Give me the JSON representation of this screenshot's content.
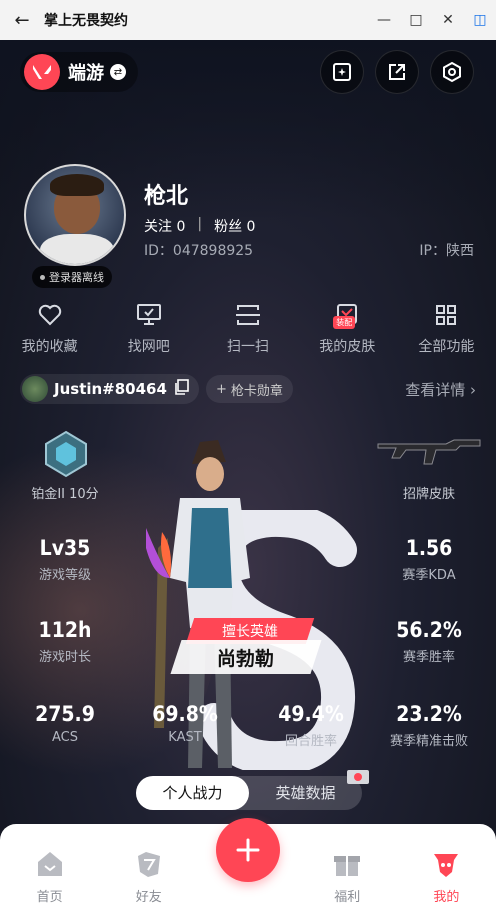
{
  "window": {
    "title": "掌上无畏契约"
  },
  "header": {
    "app_name": "端游"
  },
  "profile": {
    "username": "枪北",
    "follow_label": "关注",
    "follow_count": "0",
    "fans_label": "粉丝",
    "fans_count": "0",
    "id_text": "ID：047898925",
    "ip_text": "IP：陕西",
    "status": "登录器离线"
  },
  "actions": [
    {
      "label": "我的收藏"
    },
    {
      "label": "找网吧"
    },
    {
      "label": "扫一扫"
    },
    {
      "label": "我的皮肤",
      "badge": "装配"
    },
    {
      "label": "全部功能"
    }
  ],
  "account": {
    "tag": "Justin#80464",
    "medal": "枪卡勋章",
    "detail": "查看详情"
  },
  "rank": {
    "label": "铂金II 10分"
  },
  "skin": {
    "label": "招牌皮肤"
  },
  "stats": [
    {
      "value": "Lv35",
      "label": "游戏等级"
    },
    {
      "value": "1.56",
      "label": "赛季KDA"
    },
    {
      "value": "112h",
      "label": "游戏时长"
    },
    {
      "value": "56.2%",
      "label": "赛季胜率"
    },
    {
      "value": "275.9",
      "label": "ACS"
    },
    {
      "value": "69.8%",
      "label": "KAST"
    },
    {
      "value": "49.4%",
      "label": "回合胜率"
    },
    {
      "value": "23.2%",
      "label": "赛季精准击败"
    }
  ],
  "hero": {
    "tag": "擅长英雄",
    "name": "尚勃勒"
  },
  "segment": {
    "options": [
      "个人战力",
      "英雄数据"
    ],
    "active": 0
  },
  "bottom_nav": [
    {
      "label": "首页"
    },
    {
      "label": "好友"
    },
    {
      "label": "福利"
    },
    {
      "label": "我的"
    }
  ],
  "colors": {
    "accent": "#ff4655",
    "background": "#10131c",
    "muted_text": "#a7abb5"
  }
}
